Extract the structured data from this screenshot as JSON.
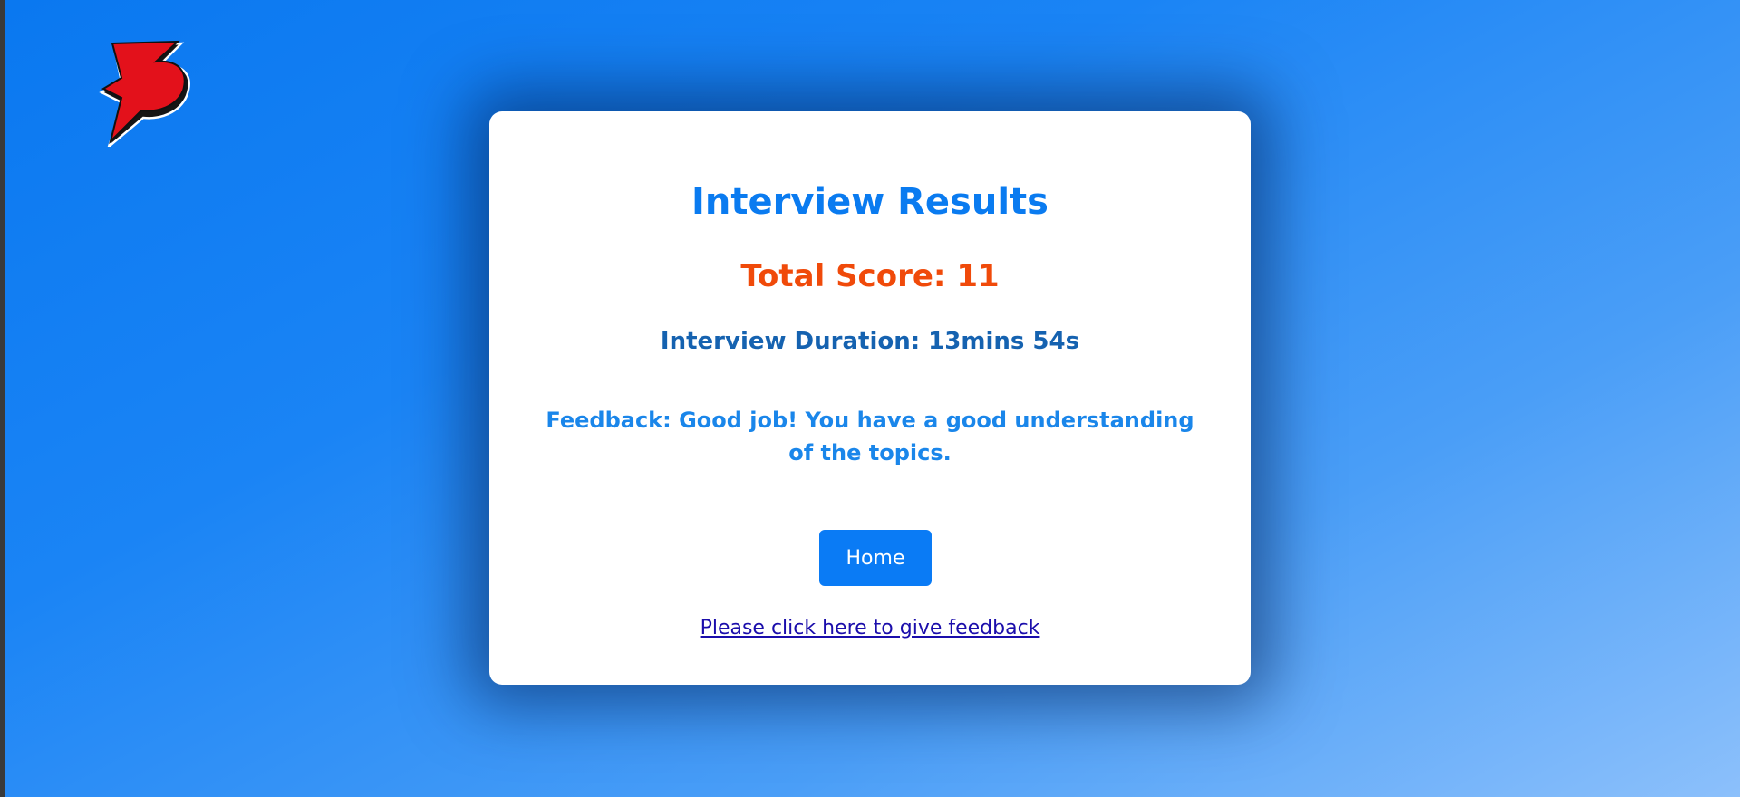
{
  "logo": {
    "icon": "red-lightning-logo-icon",
    "colors": {
      "fill": "#e3111b",
      "outline": "#1a1a1a",
      "stroke": "#ffffff"
    }
  },
  "results": {
    "title": "Interview Results",
    "total_score": "Total Score: 11",
    "duration": "Interview Duration: 13mins 54s",
    "feedback": "Feedback: Good job! You have a good understanding of the topics.",
    "home_button": "Home",
    "feedback_link": "Please click here to give feedback"
  },
  "colors": {
    "background_start": "#0a78f0",
    "background_end": "#8cc0fb",
    "title": "#0a7bf0",
    "score": "#f04a0a",
    "duration": "#1562b0",
    "feedback": "#1a86ea",
    "button": "#0a7bf5",
    "link": "#1a0dab"
  }
}
